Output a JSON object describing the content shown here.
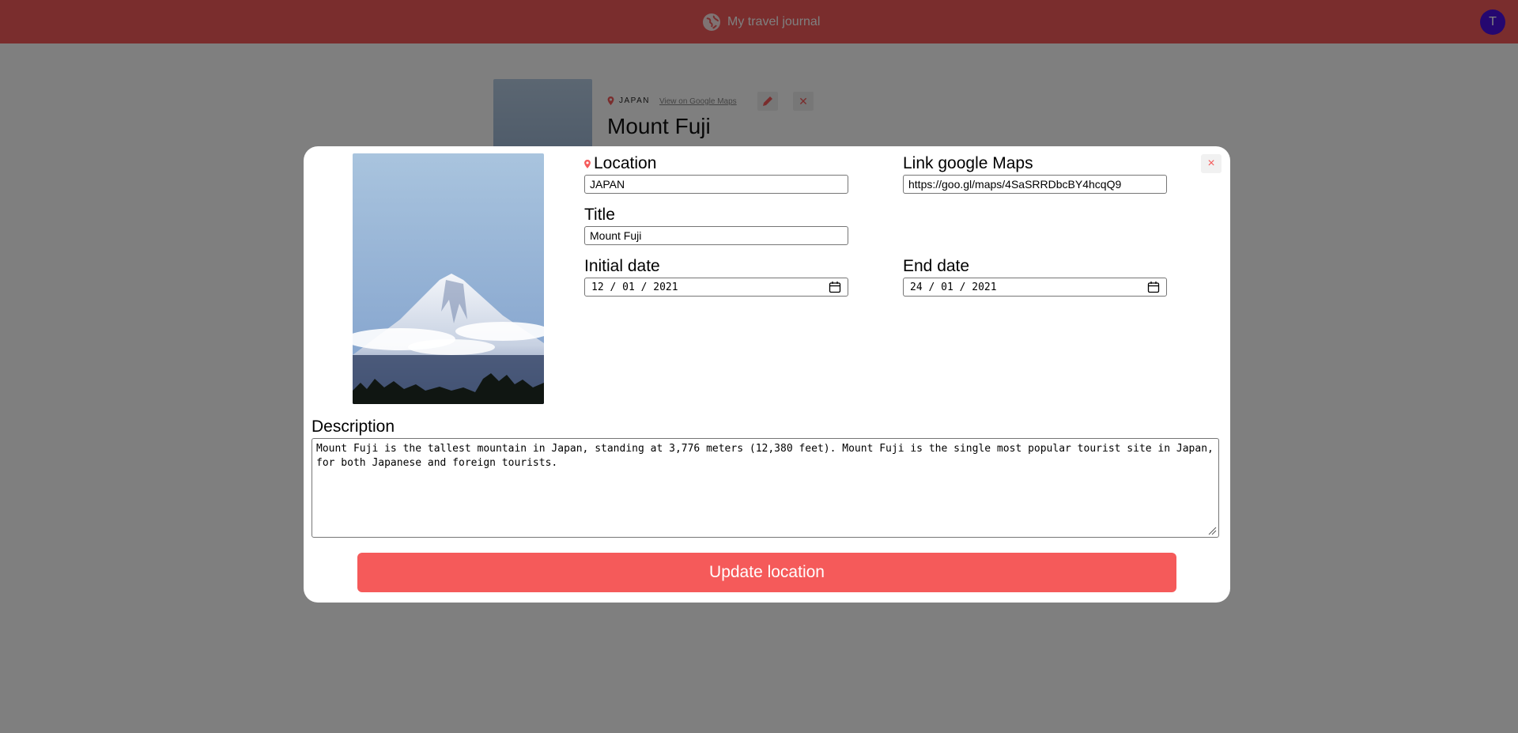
{
  "header": {
    "app_title": "My travel journal",
    "brand_icon": "globe-icon",
    "avatar_initial": "T",
    "accent_color": "#f55a5a",
    "avatar_color": "#4a0fe0"
  },
  "background_entry": {
    "location": "JAPAN",
    "map_link_label": "View on Google Maps",
    "title": "Mount Fuji",
    "edit_icon": "pencil-icon",
    "delete_icon": "close-icon"
  },
  "modal": {
    "close_label": "×",
    "photo_icon": "mountain-photo",
    "location": {
      "label": "Location",
      "value": "JAPAN"
    },
    "maps_link": {
      "label": "Link google Maps",
      "value": "https://goo.gl/maps/4SaSRRDbcBY4hcqQ9"
    },
    "title": {
      "label": "Title",
      "value": "Mount Fuji"
    },
    "initial_date": {
      "label": "Initial date",
      "value": "12 / 01 / 2021"
    },
    "end_date": {
      "label": "End date",
      "value": "24 / 01 / 2021"
    },
    "description": {
      "label": "Description",
      "value": "Mount Fuji is the tallest mountain in Japan, standing at 3,776 meters (12,380 feet). Mount Fuji is the single most popular tourist site in Japan, for both Japanese and foreign tourists."
    },
    "submit_label": "Update location"
  }
}
